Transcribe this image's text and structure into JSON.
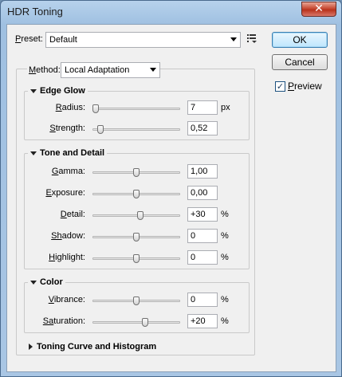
{
  "window": {
    "title": "HDR Toning",
    "close_label": "✕"
  },
  "preset": {
    "label_u": "P",
    "label_rest": "reset:",
    "value": "Default",
    "menu_icon": "list-menu-icon"
  },
  "buttons": {
    "ok": "OK",
    "cancel": "Cancel"
  },
  "preview": {
    "label_u": "P",
    "label_rest": "review",
    "checked": true,
    "mark": "✓"
  },
  "method": {
    "label_u": "M",
    "label_rest": "ethod:",
    "value": "Local Adaptation"
  },
  "edge_glow": {
    "title": "Edge Glow",
    "rows": [
      {
        "u": "R",
        "rest": "adius:",
        "value": "7",
        "unit": "px",
        "level": 0.03
      },
      {
        "u": "S",
        "rest": "trength:",
        "value": "0,52",
        "unit": "",
        "level": 0.08
      }
    ]
  },
  "tone_detail": {
    "title": "Tone and Detail",
    "rows": [
      {
        "u": "G",
        "rest": "amma:",
        "value": "1,00",
        "unit": "",
        "level": 0.5
      },
      {
        "u": "E",
        "rest": "xposure:",
        "value": "0,00",
        "unit": "",
        "level": 0.5
      },
      {
        "u": "D",
        "rest": "etail:",
        "value": "+30",
        "unit": "%",
        "level": 0.55
      },
      {
        "u": "Sh",
        "rest": "adow:",
        "value": "0",
        "unit": "%",
        "level": 0.5
      },
      {
        "u": "H",
        "rest": "ighlight:",
        "value": "0",
        "unit": "%",
        "level": 0.5
      }
    ]
  },
  "color": {
    "title": "Color",
    "rows": [
      {
        "u": "V",
        "rest": "ibrance:",
        "value": "0",
        "unit": "%",
        "level": 0.5
      },
      {
        "u": "Sa",
        "rest": "turation:",
        "value": "+20",
        "unit": "%",
        "level": 0.6
      }
    ]
  },
  "toning_curve": {
    "title": "Toning Curve and Histogram"
  }
}
